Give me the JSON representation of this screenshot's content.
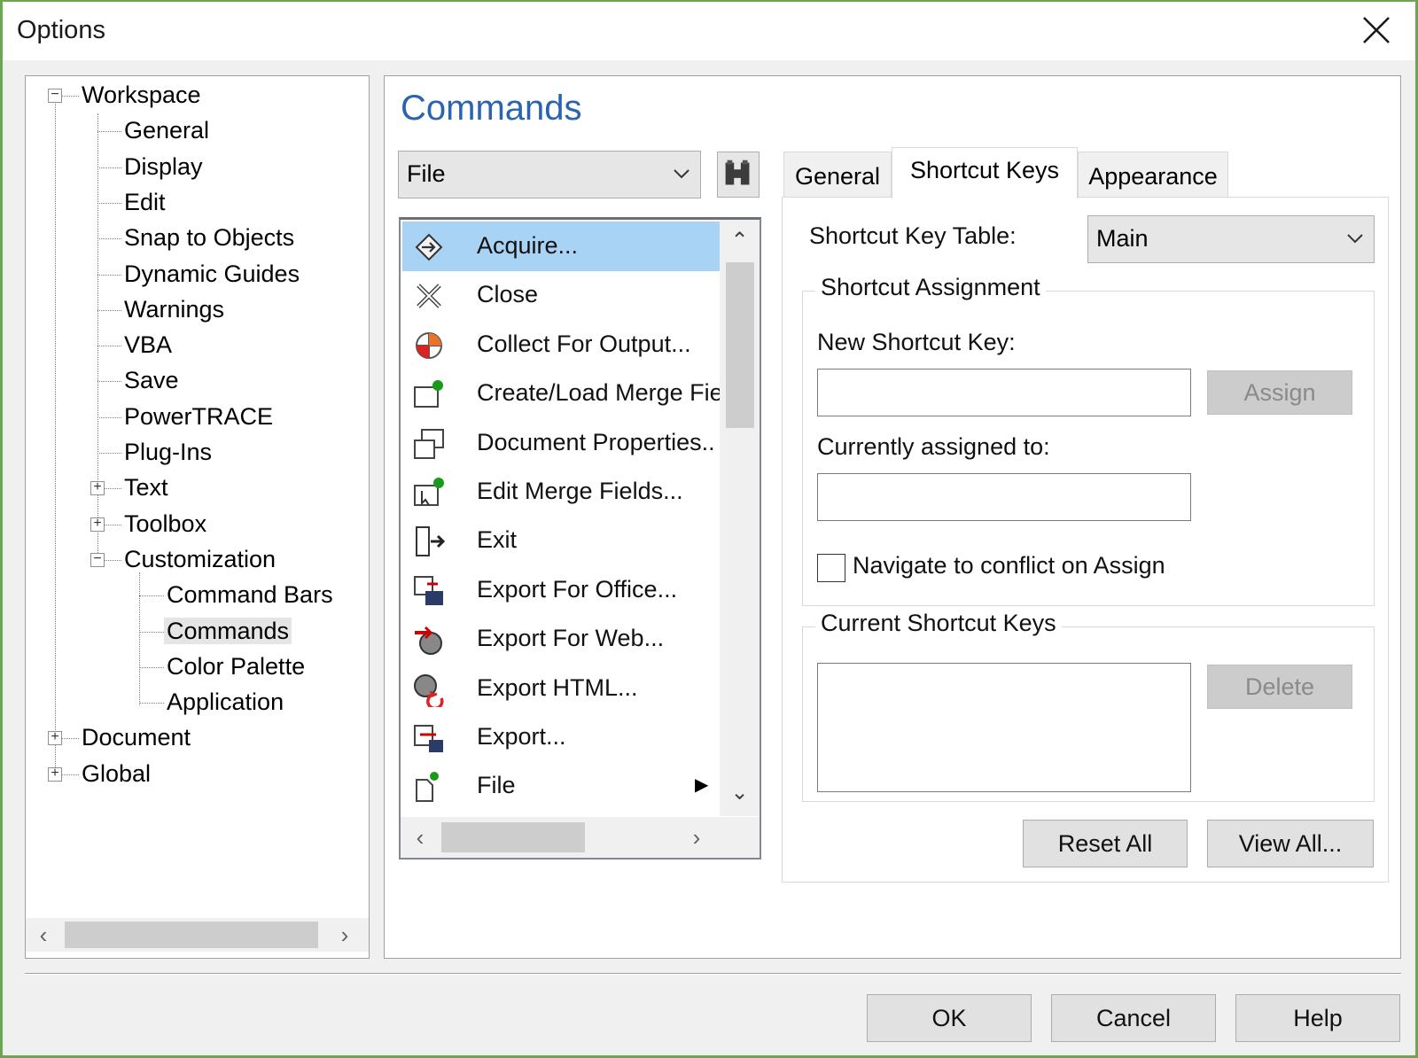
{
  "window": {
    "title": "Options"
  },
  "tree": {
    "items": [
      {
        "label": "Workspace",
        "expander": "minus"
      },
      {
        "label": "General"
      },
      {
        "label": "Display"
      },
      {
        "label": "Edit"
      },
      {
        "label": "Snap to Objects"
      },
      {
        "label": "Dynamic Guides"
      },
      {
        "label": "Warnings"
      },
      {
        "label": "VBA"
      },
      {
        "label": "Save"
      },
      {
        "label": "PowerTRACE"
      },
      {
        "label": "Plug-Ins"
      },
      {
        "label": "Text",
        "expander": "plus"
      },
      {
        "label": "Toolbox",
        "expander": "plus"
      },
      {
        "label": "Customization",
        "expander": "minus"
      },
      {
        "label": "Command Bars"
      },
      {
        "label": "Commands",
        "selected": true
      },
      {
        "label": "Color Palette"
      },
      {
        "label": "Application"
      },
      {
        "label": "Document",
        "expander": "plus"
      },
      {
        "label": "Global",
        "expander": "plus"
      }
    ]
  },
  "main": {
    "heading": "Commands",
    "category_select": {
      "value": "File"
    },
    "find_button": {
      "icon": "binoculars-icon"
    },
    "commands": [
      {
        "label": "Acquire...",
        "icon": "acquire-icon",
        "selected": true
      },
      {
        "label": "Close",
        "icon": "close-doc-icon"
      },
      {
        "label": "Collect For Output...",
        "icon": "collect-output-icon"
      },
      {
        "label": "Create/Load Merge Fie",
        "icon": "merge-file-icon"
      },
      {
        "label": "Document Properties..",
        "icon": "document-properties-icon"
      },
      {
        "label": "Edit Merge Fields...",
        "icon": "edit-merge-icon"
      },
      {
        "label": "Exit",
        "icon": "exit-icon"
      },
      {
        "label": "Export For Office...",
        "icon": "export-office-icon"
      },
      {
        "label": "Export For Web...",
        "icon": "export-web-icon"
      },
      {
        "label": "Export HTML...",
        "icon": "export-html-icon"
      },
      {
        "label": "Export...",
        "icon": "export-icon"
      },
      {
        "label": "File",
        "icon": "file-new-icon",
        "submenu": true
      }
    ],
    "tabs": [
      {
        "label": "General"
      },
      {
        "label": "Shortcut Keys",
        "active": true
      },
      {
        "label": "Appearance"
      }
    ],
    "shortcut_tab": {
      "table_label": "Shortcut Key Table:",
      "table_value": "Main",
      "assignment_group": "Shortcut Assignment",
      "new_key_label": "New Shortcut Key:",
      "new_key_value": "",
      "assign_button": "Assign",
      "assigned_to_label": "Currently assigned to:",
      "assigned_to_value": "",
      "navigate_checkbox": {
        "label": "Navigate to conflict on Assign",
        "checked": false
      },
      "current_group": "Current Shortcut Keys",
      "delete_button": "Delete",
      "reset_button": "Reset All",
      "view_button": "View All..."
    }
  },
  "footer": {
    "ok": "OK",
    "cancel": "Cancel",
    "help": "Help"
  }
}
